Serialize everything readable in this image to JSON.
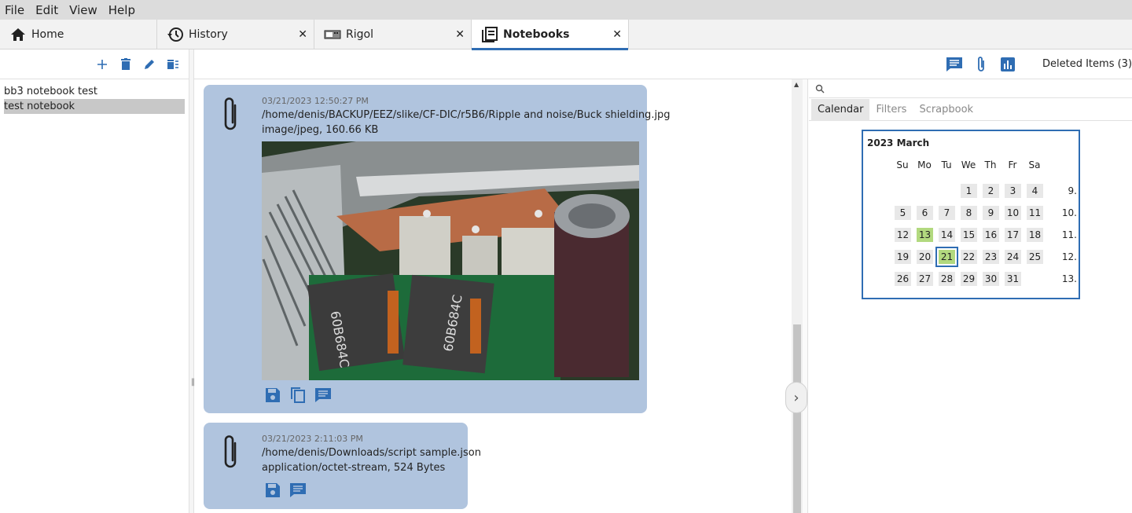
{
  "menu": [
    "File",
    "Edit",
    "View",
    "Help"
  ],
  "tabs": [
    {
      "label": "Home",
      "icon": "home-icon",
      "closable": false
    },
    {
      "label": "History",
      "icon": "history-icon",
      "closable": true
    },
    {
      "label": "Rigol",
      "icon": "instrument-icon",
      "closable": true
    },
    {
      "label": "Notebooks",
      "icon": "notebooks-icon",
      "closable": true,
      "active": true
    }
  ],
  "sidebar": {
    "notebooks": [
      "bb3 notebook test",
      "test notebook"
    ],
    "selected_index": 1
  },
  "toolbar": {
    "deleted_items": "Deleted Items (3)"
  },
  "entries": [
    {
      "timestamp": "03/21/2023 12:50:27 PM",
      "path": "/home/denis/BACKUP/EEZ/slike/CF-DIC/r5B6/Ripple and noise/Buck shielding.jpg",
      "mime": "image/jpeg, 160.66 KB"
    },
    {
      "timestamp": "03/21/2023 2:11:03 PM",
      "path": "/home/denis/Downloads/script sample.json",
      "mime": "application/octet-stream, 524 Bytes"
    }
  ],
  "right_panel": {
    "tabs": [
      "Calendar",
      "Filters",
      "Scrapbook"
    ],
    "active_tab": "Calendar"
  },
  "calendar": {
    "title": "2023 March",
    "weekdays": [
      "Su",
      "Mo",
      "Tu",
      "We",
      "Th",
      "Fr",
      "Sa"
    ],
    "weeks": [
      {
        "num": "9.",
        "days": [
          "",
          "",
          "",
          "1",
          "2",
          "3",
          "4"
        ]
      },
      {
        "num": "10.",
        "days": [
          "5",
          "6",
          "7",
          "8",
          "9",
          "10",
          "11"
        ]
      },
      {
        "num": "11.",
        "days": [
          "12",
          "13",
          "14",
          "15",
          "16",
          "17",
          "18"
        ]
      },
      {
        "num": "12.",
        "days": [
          "19",
          "20",
          "21",
          "22",
          "23",
          "24",
          "25"
        ]
      },
      {
        "num": "13.",
        "days": [
          "26",
          "27",
          "28",
          "29",
          "30",
          "31",
          ""
        ]
      }
    ],
    "highlighted": [
      "13",
      "21"
    ],
    "today": "21",
    "accent": "#2f6db3",
    "highlight_color": "#b2d97f"
  }
}
